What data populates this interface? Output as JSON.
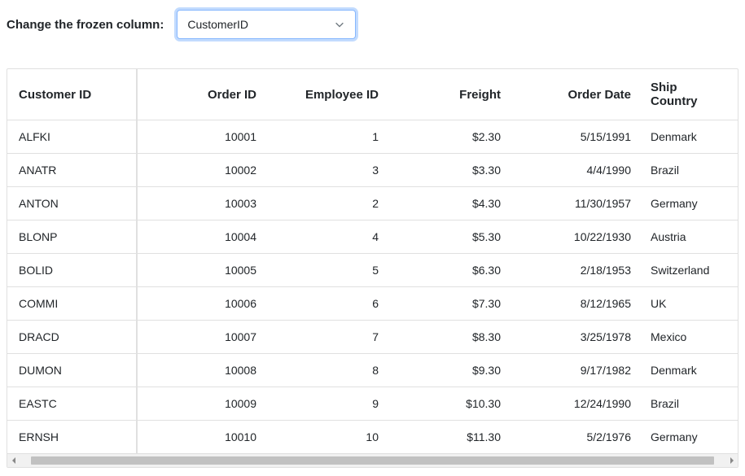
{
  "control": {
    "label": "Change the frozen column:",
    "selected": "CustomerID"
  },
  "grid": {
    "columns": [
      {
        "key": "customerId",
        "label": "Customer ID",
        "cls": "col-customer",
        "frozen": true
      },
      {
        "key": "orderId",
        "label": "Order ID",
        "cls": "col-order"
      },
      {
        "key": "employeeId",
        "label": "Employee ID",
        "cls": "col-employee"
      },
      {
        "key": "freight",
        "label": "Freight",
        "cls": "col-freight"
      },
      {
        "key": "orderDate",
        "label": "Order Date",
        "cls": "col-orderdate"
      },
      {
        "key": "shipCountry",
        "label": "Ship Country",
        "cls": "col-shipcountry"
      }
    ],
    "rows": [
      {
        "customerId": "ALFKI",
        "orderId": "10001",
        "employeeId": "1",
        "freight": "$2.30",
        "orderDate": "5/15/1991",
        "shipCountry": "Denmark"
      },
      {
        "customerId": "ANATR",
        "orderId": "10002",
        "employeeId": "3",
        "freight": "$3.30",
        "orderDate": "4/4/1990",
        "shipCountry": "Brazil"
      },
      {
        "customerId": "ANTON",
        "orderId": "10003",
        "employeeId": "2",
        "freight": "$4.30",
        "orderDate": "11/30/1957",
        "shipCountry": "Germany"
      },
      {
        "customerId": "BLONP",
        "orderId": "10004",
        "employeeId": "4",
        "freight": "$5.30",
        "orderDate": "10/22/1930",
        "shipCountry": "Austria"
      },
      {
        "customerId": "BOLID",
        "orderId": "10005",
        "employeeId": "5",
        "freight": "$6.30",
        "orderDate": "2/18/1953",
        "shipCountry": "Switzerland"
      },
      {
        "customerId": "COMMI",
        "orderId": "10006",
        "employeeId": "6",
        "freight": "$7.30",
        "orderDate": "8/12/1965",
        "shipCountry": "UK"
      },
      {
        "customerId": "DRACD",
        "orderId": "10007",
        "employeeId": "7",
        "freight": "$8.30",
        "orderDate": "3/25/1978",
        "shipCountry": "Mexico"
      },
      {
        "customerId": "DUMON",
        "orderId": "10008",
        "employeeId": "8",
        "freight": "$9.30",
        "orderDate": "9/17/1982",
        "shipCountry": "Denmark"
      },
      {
        "customerId": "EASTC",
        "orderId": "10009",
        "employeeId": "9",
        "freight": "$10.30",
        "orderDate": "12/24/1990",
        "shipCountry": "Brazil"
      },
      {
        "customerId": "ERNSH",
        "orderId": "10010",
        "employeeId": "10",
        "freight": "$11.30",
        "orderDate": "5/2/1976",
        "shipCountry": "Germany"
      }
    ]
  }
}
